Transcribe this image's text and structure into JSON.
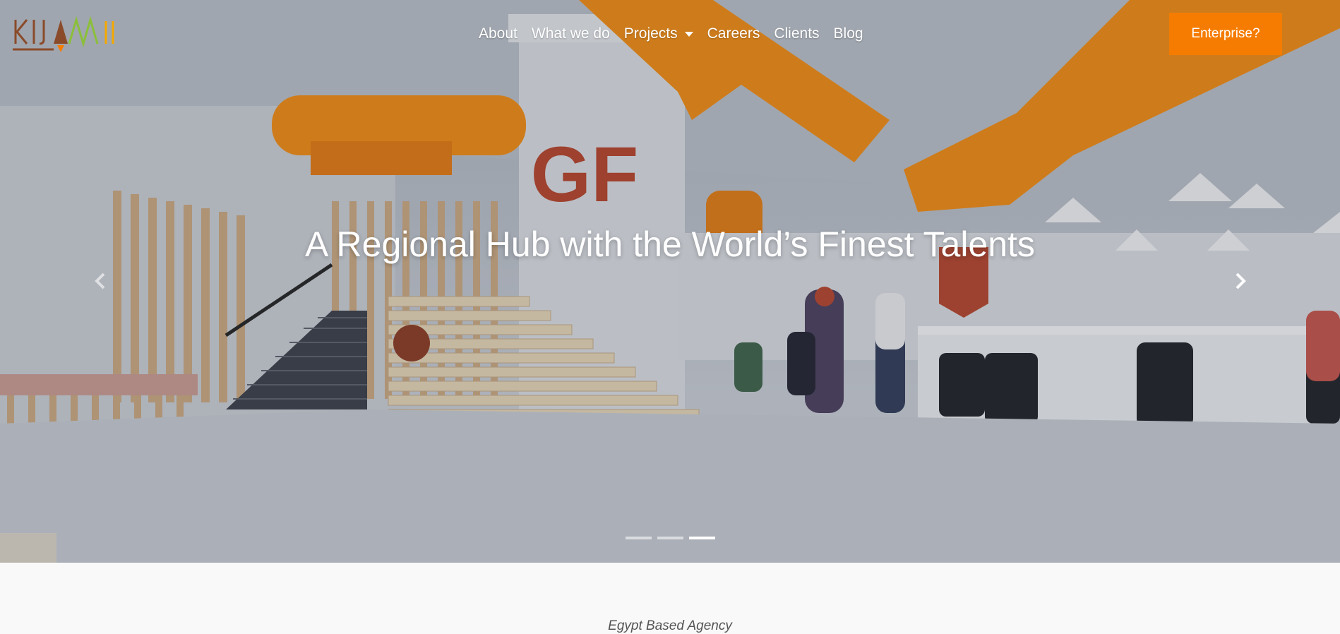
{
  "brand": {
    "logo_text": "KIJAMII",
    "accent_color": "#f57c00"
  },
  "nav": {
    "items": [
      {
        "label": "About"
      },
      {
        "label": "What we do"
      },
      {
        "label": "Projects",
        "has_dropdown": true
      },
      {
        "label": "Careers"
      },
      {
        "label": "Clients"
      },
      {
        "label": "Blog"
      }
    ],
    "cta_label": "Enterprise?"
  },
  "hero": {
    "title": "A Regional Hub with the World’s Finest Talents",
    "slide_count": 3,
    "active_slide": 3,
    "prev_icon": "chevron-left-icon",
    "next_icon": "chevron-right-icon",
    "wall_sign": "GF"
  },
  "intro": {
    "tagline": "Egypt Based Agency"
  }
}
